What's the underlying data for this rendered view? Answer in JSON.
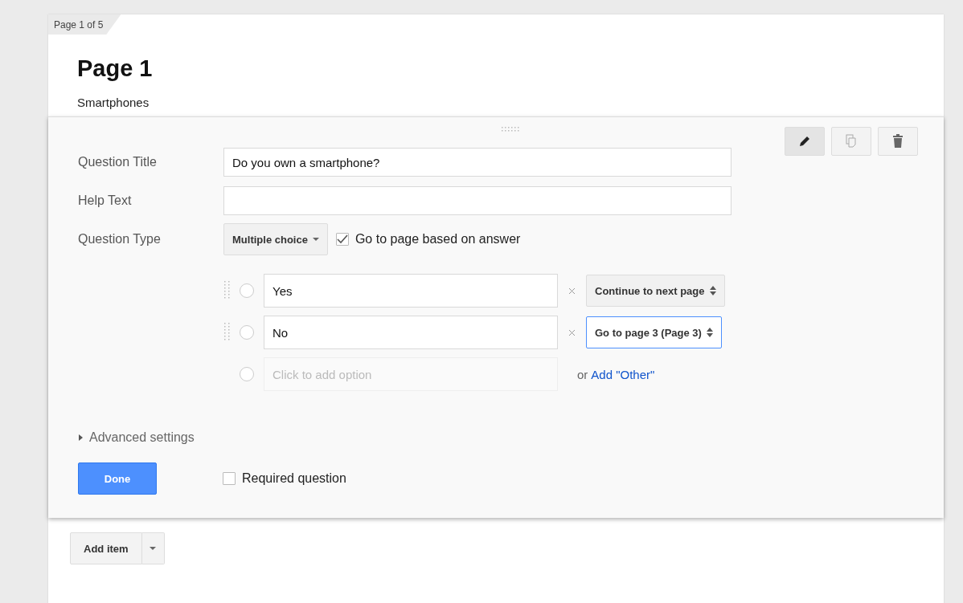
{
  "page_tab": "Page 1 of 5",
  "page": {
    "title": "Page 1",
    "description": "Smartphones"
  },
  "editor": {
    "tools": [
      {
        "kind": "edit",
        "selected": true
      },
      {
        "kind": "duplicate",
        "selected": false
      },
      {
        "kind": "delete",
        "selected": false
      }
    ],
    "fields": [
      {
        "label": "Question Title",
        "value": "Do you own a smartphone?"
      },
      {
        "label": "Help Text"
      }
    ],
    "question_type": {
      "label": "Question Type",
      "value": "Multiple choice",
      "go_to_page": {
        "label": "Go to page based on answer",
        "checked": true
      }
    },
    "options": [
      {
        "value": "Yes",
        "selected": false,
        "destination": "Continue to next page",
        "focused": false
      },
      {
        "value": "No",
        "selected": false,
        "destination": "Go to page 3 (Page 3)",
        "focused": true
      }
    ],
    "new_option": {
      "selected": false,
      "placeholder": "Click to add option",
      "or_text": "or",
      "other_link": "Add \"Other\""
    },
    "advanced": {
      "label": "Advanced settings",
      "expanded": false
    },
    "done": "Done",
    "required": {
      "label": "Required question",
      "checked": false
    }
  },
  "add_item": "Add item"
}
